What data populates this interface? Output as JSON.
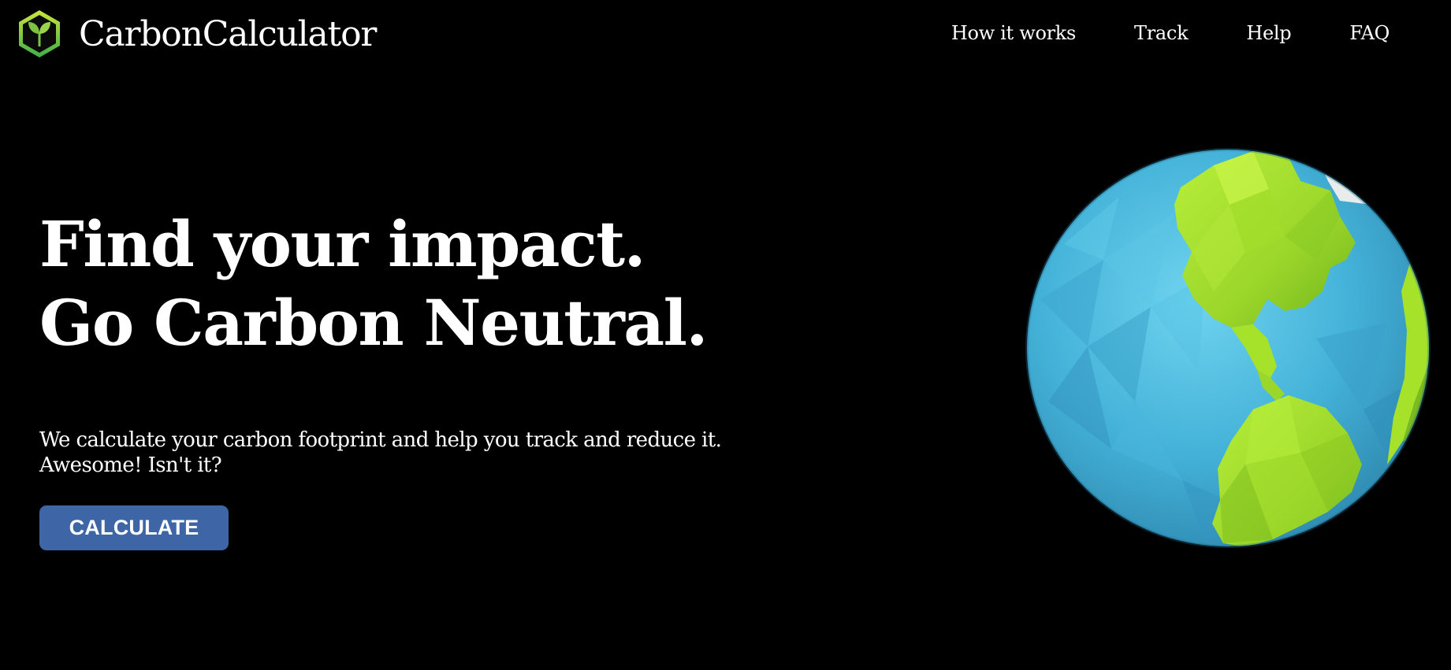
{
  "header": {
    "logo_icon": "sprout-hexagon-icon",
    "brand_name": "CarbonCalculator",
    "nav": [
      {
        "label": "How it works"
      },
      {
        "label": "Track"
      },
      {
        "label": "Help"
      },
      {
        "label": "FAQ"
      }
    ]
  },
  "hero": {
    "headline_line1": "Find your impact.",
    "headline_line2": "Go Carbon Neutral.",
    "subtext_line1": "We calculate your carbon footprint and help you track and reduce it.",
    "subtext_line2": "Awesome! Isn't it?",
    "cta_label": "CALCULATE"
  },
  "illustration": {
    "icon": "low-poly-earth-globe"
  },
  "colors": {
    "background": "#000000",
    "text": "#ffffff",
    "button": "#3e66a6",
    "logo_green": "#7dc242",
    "ocean": "#45b3d6",
    "land": "#a6e22a"
  }
}
